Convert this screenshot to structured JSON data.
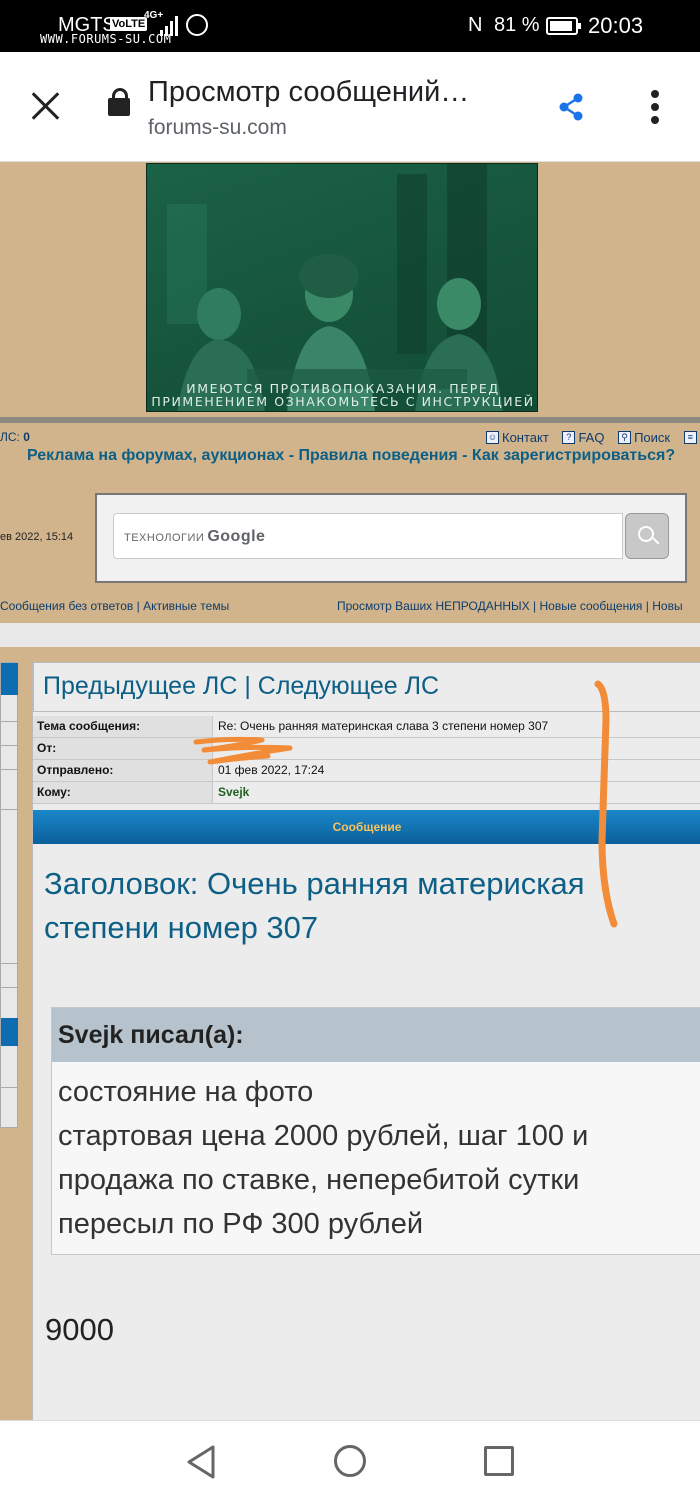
{
  "status_bar": {
    "carrier": "MGTS",
    "volte": "VoLTE",
    "network": "4G+",
    "watermark": "WWW.FORUMS-SU.COM",
    "nfc": "N",
    "battery": "81 %",
    "time": "20:03"
  },
  "browser": {
    "title": "Просмотр сообщений…",
    "url": "forums-su.com"
  },
  "ad": {
    "caption_line1": "ИМЕЮТСЯ ПРОТИВОПОКАЗАНИЯ. ПЕРЕД",
    "caption_line2": "ПРИМЕНЕНИЕМ ОЗНАКОМЬТЕСЬ С ИНСТРУКЦИЕЙ"
  },
  "forum": {
    "ls_label": "ЛС: ",
    "ls_count": "0",
    "toplinks": [
      {
        "label": "Контакт",
        "icon": "contact-icon"
      },
      {
        "label": "FAQ",
        "icon": "faq-icon"
      },
      {
        "label": "Поиск",
        "icon": "search-icon"
      }
    ],
    "rules": {
      "ads": "Реклама на форумах, аукционах",
      "sep": " - ",
      "rules": "Правила поведения",
      "register": "Как зарегистрироваться?"
    },
    "date": "ев 2022, 15:14",
    "search": {
      "powered": "ТЕХНОЛОГИИ",
      "brand": "Google"
    },
    "nav_left": {
      "item1": "Сообщения без ответов",
      "sep": " | ",
      "item2": "Активные темы"
    },
    "nav_right": {
      "item1": "Просмотр Ваших НЕПРОДАННЫХ",
      "sep": " | ",
      "item2": "Новые сообщения",
      "item3": "Новы"
    }
  },
  "pm": {
    "prev": "Предыдущее ЛС",
    "sep": " | ",
    "next": "Следующее ЛС",
    "meta": {
      "subject_label": "Тема сообщения:",
      "subject_value": "Re: Очень ранняя материнская слава 3 степени номер 307",
      "from_label": "От:",
      "from_value": "",
      "sent_label": "Отправлено:",
      "sent_value": "01 фев 2022, 17:24",
      "to_label": "Кому:",
      "to_value": "Svejk"
    },
    "message_header": "Сообщение",
    "title_line1": "Заголовок: Очень ранняя матери",
    "title_line1b": "ская",
    "title_line2": "степени номер 307",
    "quote": {
      "author": "Svejk писал(а):",
      "lines": [
        "состояние на фото",
        "стартовая цена 2000 рублей, шаг 100 и",
        "продажа по ставке, неперебитой сутки",
        "пересыл по РФ 300 рублей"
      ]
    },
    "reply": "9000"
  },
  "colors": {
    "accent": "#0d5f85",
    "header_bar": "#0e6db1",
    "header_text": "#f7c35f",
    "annotation": "#f28c38",
    "page_bg": "#d2b48c"
  }
}
